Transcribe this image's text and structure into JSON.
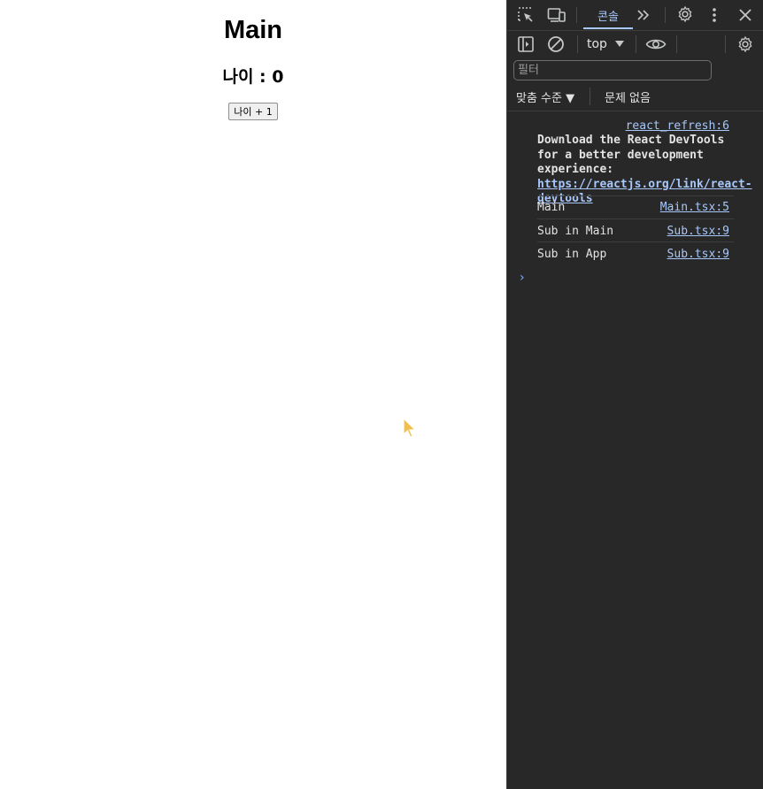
{
  "page": {
    "title": "Main",
    "age_text": "나이 : 0",
    "age_button_label": "나이 + 1"
  },
  "devtools": {
    "tabs": {
      "console_label": "콘솔"
    },
    "toolbar": {
      "context_label": "top"
    },
    "filter": {
      "placeholder": "필터"
    },
    "levels": {
      "levels_label": "맞춤 수준 ▼",
      "issues_label": "문제 없음"
    },
    "console": {
      "messages": [
        {
          "source": "react_refresh:6",
          "text_prefix": "Download the React DevTools for a better development experience: ",
          "link": "https://reactjs.org/link/react-devtools"
        },
        {
          "text": "Main",
          "source": "Main.tsx:5"
        },
        {
          "text": "Sub in Main",
          "source": "Sub.tsx:9"
        },
        {
          "text": "Sub in App",
          "source": "Sub.tsx:9"
        }
      ],
      "prompt": "›"
    }
  },
  "icons": [
    "inspect-element-icon",
    "device-toolbar-icon",
    "more-tabs-icon",
    "settings-icon",
    "kebab-menu-icon",
    "close-icon",
    "sidebar-toggle-icon",
    "clear-console-icon",
    "context-dropdown-icon",
    "live-expression-eye-icon",
    "console-settings-icon",
    "mouse-cursor-icon"
  ],
  "colors": {
    "devtools_bg": "#282828",
    "accent": "#a8c7fa",
    "text": "#e3e3e3"
  }
}
